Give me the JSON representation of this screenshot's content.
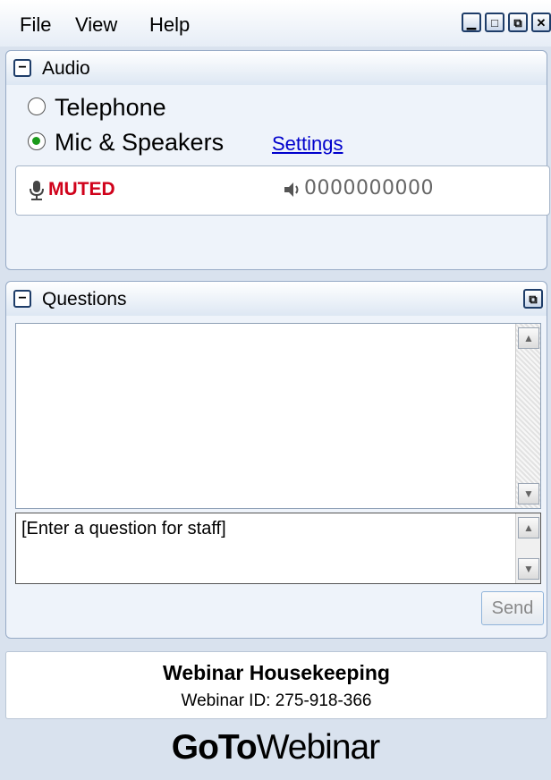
{
  "menubar": {
    "items": [
      "File",
      "View",
      "Help"
    ]
  },
  "window_controls": {
    "minimize": "minimize-icon",
    "maximize": "maximize-icon",
    "restore": "restore-icon",
    "close": "close-icon"
  },
  "audio": {
    "title": "Audio",
    "options": [
      {
        "label": "Telephone",
        "selected": false
      },
      {
        "label": "Mic & Speakers",
        "selected": true
      }
    ],
    "settings_link": "Settings",
    "mic_status": "MUTED",
    "volume_meter": "0000000000",
    "status_color": "#d0021b"
  },
  "questions": {
    "title": "Questions",
    "input_placeholder": "[Enter a question for staff]",
    "send_label": "Send"
  },
  "info": {
    "title": "Webinar Housekeeping",
    "webinar_id": "Webinar ID: 275-918-366"
  },
  "brand": {
    "bold": "GoTo",
    "regular": "Webinar"
  }
}
